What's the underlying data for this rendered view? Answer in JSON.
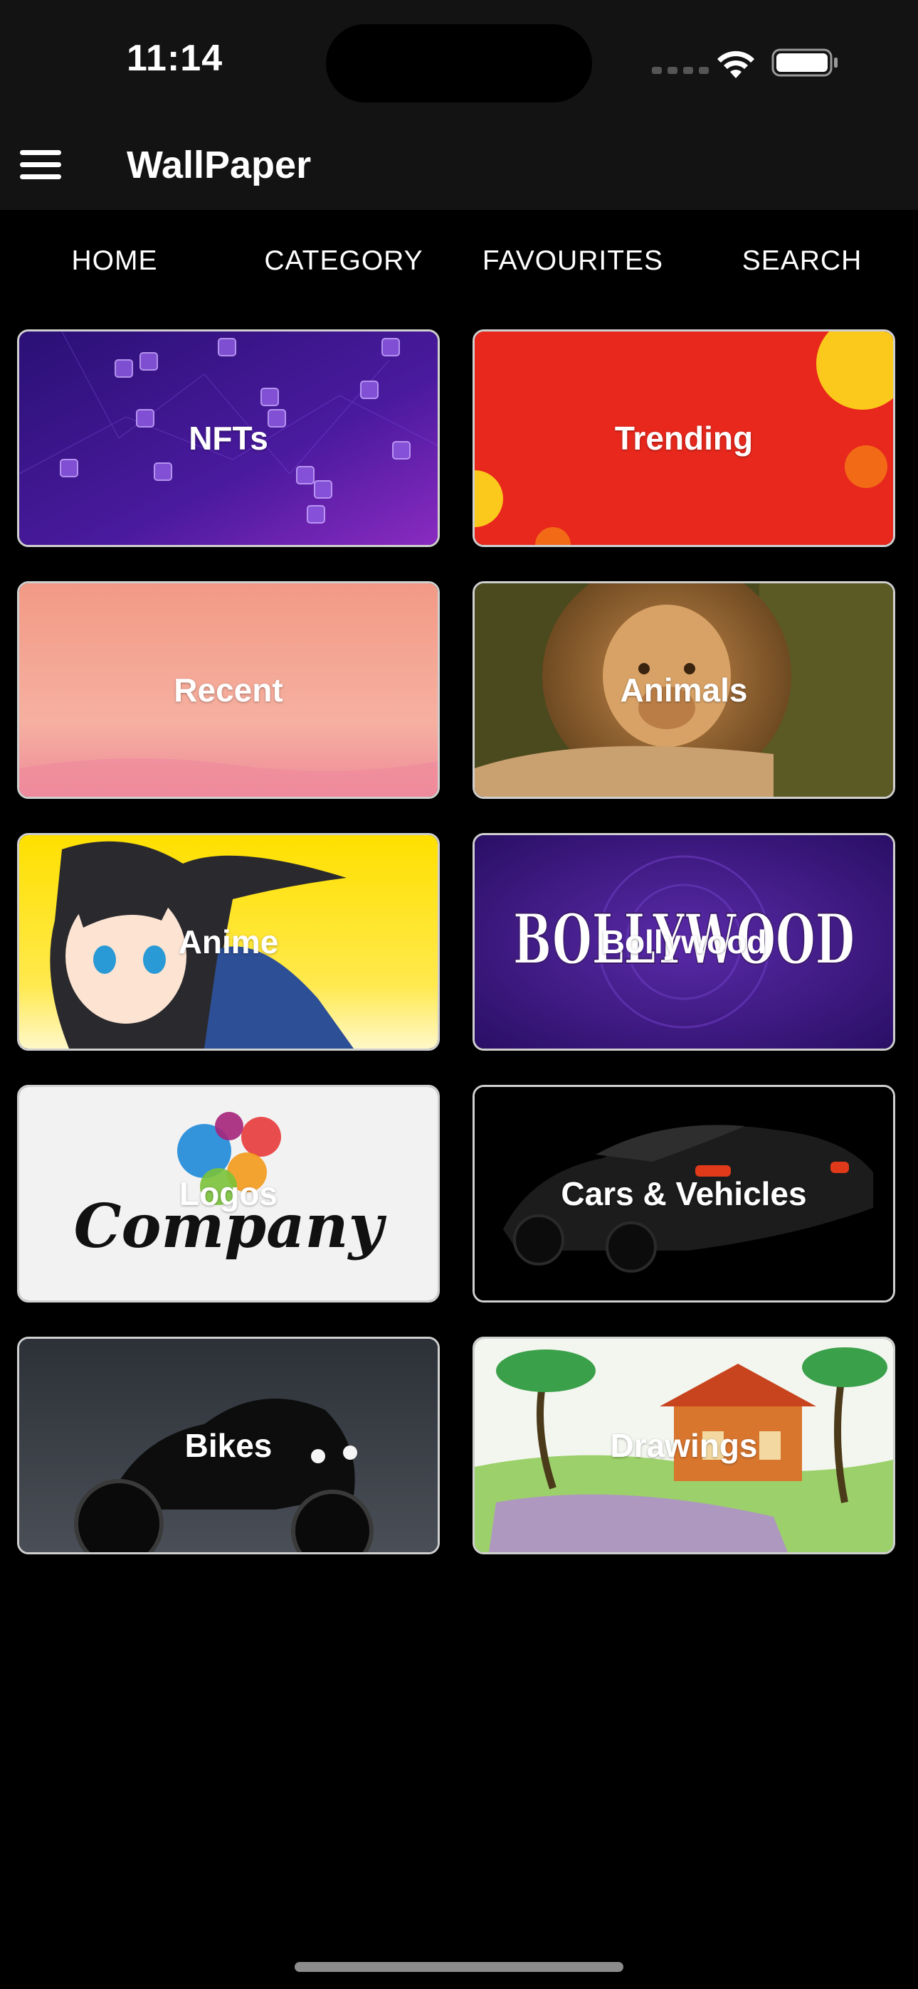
{
  "status_bar": {
    "time": "11:14"
  },
  "app_bar": {
    "title": "WallPaper"
  },
  "tabs": [
    {
      "label": "HOME"
    },
    {
      "label": "CATEGORY"
    },
    {
      "label": "FAVOURITES"
    },
    {
      "label": "SEARCH"
    }
  ],
  "categories": [
    {
      "label": "NFTs"
    },
    {
      "label": "Trending"
    },
    {
      "label": "Recent"
    },
    {
      "label": "Animals"
    },
    {
      "label": "Anime"
    },
    {
      "label": "Bollywood",
      "art_text": "BOLLYWOOD"
    },
    {
      "label": "Logos",
      "art_text": "Company"
    },
    {
      "label": "Cars & Vehicles"
    },
    {
      "label": "Bikes"
    },
    {
      "label": "Drawings"
    }
  ],
  "colors": {
    "background": "#000000",
    "bar_background": "#131313",
    "card_border": "#cfcfcf",
    "text": "#ffffff"
  },
  "icons": {
    "menu": "hamburger-menu-icon",
    "wifi": "wifi-icon",
    "battery": "battery-icon",
    "signal": "signal-icon"
  }
}
